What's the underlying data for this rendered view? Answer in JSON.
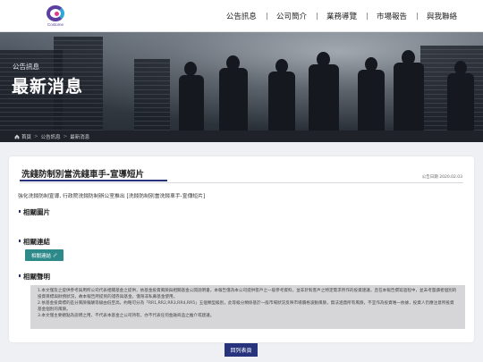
{
  "brand": {
    "logo_text": "Costome"
  },
  "nav": [
    "公告訊息",
    "公司簡介",
    "業務導覽",
    "市場報告",
    "與我聯絡"
  ],
  "banner": {
    "subtitle": "公告訊息",
    "title": "最新消息"
  },
  "breadcrumb": [
    "首頁",
    "公告訊息",
    "最新消息"
  ],
  "article": {
    "title": "洗錢防制別當洗錢車手-宣導短片",
    "date": "公告日期 2020.02.03",
    "lead": "強化洗錢防制宣導, 行政院洗錢防制辦公室推出 [洗錢防制別當洗錢車手-宣傳短片]"
  },
  "sections": {
    "images": "相關圖片",
    "links": "相關連結",
    "disclaimer": "相關聲明"
  },
  "link_button": "相關連結",
  "disclaimer_lines": [
    "1.本文僅及之提供參考與用所公司代表相關基金之提供，依基金投資風險與相關基金公開說明書，本報告僅為本公司提供客戶之一般參考資料，並非針對客戶之特定需求所作的投資建議，且在本報告撰寫過程中，並未考量讀者個別的投資目標與財務狀況，故本報告所提到的證券與基金，僅限非私募基金使用。",
    "2.依基金投資標的區分風險報酬等級由低至高，約略可分為「RR1,RR2,RR3,RR4,RR5」五個類型級別，此等級分類係基於一般市場狀況反映市場價格波動風險，無法涵蓋所有風險，不宜作為投資唯一依據，投資人仍應注意所投資基金個別的風險。",
    "3.本文僅主要觀點為說明之用，不代表本基金之公司持有，亦不代表任何金融商品之推介或建議。"
  ],
  "back_button": "回列表頁",
  "colors": {
    "primary": "#27347d",
    "teal": "#2e8a8a",
    "crumbbar": "#1f2329"
  }
}
